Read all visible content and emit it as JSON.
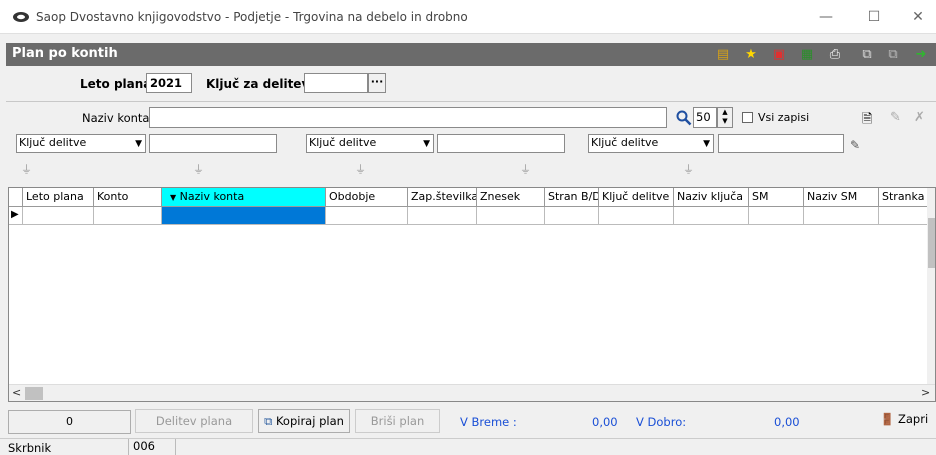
{
  "window": {
    "title": "Saop Dvostavno knjigovodstvo - Podjetje - Trgovina na debelo in drobno",
    "minimize": "—",
    "maximize": "☐",
    "close": "✕"
  },
  "header": {
    "title": "Plan po kontih"
  },
  "plan": {
    "year_label": "Leto plana",
    "year_value": "2021",
    "key_label": "Ključ za delitev",
    "key_value": "",
    "browse_label": "···"
  },
  "search": {
    "label": "Naziv konta",
    "value": "",
    "count": "50",
    "all_records_label": "Vsi zapisi"
  },
  "filters": [
    {
      "combo": "Ključ delitve",
      "value": ""
    },
    {
      "combo": "Ključ delitve",
      "value": ""
    },
    {
      "combo": "Ključ delitve",
      "value": ""
    }
  ],
  "grid": {
    "columns": [
      "Leto plana",
      "Konto",
      "Naziv konta",
      "Obdobje",
      "Zap.številka",
      "Znesek",
      "Stran B/D",
      "Ključ delitve",
      "Naziv ključa",
      "SM",
      "Naziv SM",
      "Stranka"
    ],
    "sorted_column": "Naziv konta",
    "row_marker": "▶"
  },
  "footer": {
    "count": "0",
    "delitev_btn": "Delitev plana",
    "kopiraj_btn": "Kopiraj plan",
    "brisi_btn": "Briši plan",
    "breme_label": "V Breme :",
    "breme_value": "0,00",
    "dobro_label": "V Dobro:",
    "dobro_value": "0,00",
    "close_btn": "Zapri"
  },
  "status": {
    "user_label": "Skrbnik",
    "code": "006"
  },
  "colors": {
    "header_bg": "#6b6b6b",
    "sorted_header": "#00ffff",
    "selected_cell": "#0078d7",
    "totals_text": "#1a4fd6"
  }
}
